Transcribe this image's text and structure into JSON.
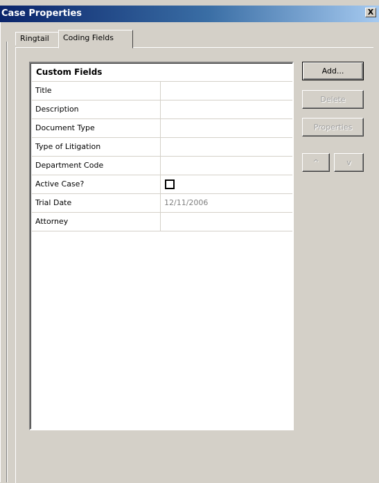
{
  "window": {
    "title": "Case Properties",
    "close_label": "X"
  },
  "tabs": [
    {
      "label": "Ringtail",
      "selected": false
    },
    {
      "label": "Coding Fields",
      "selected": true
    }
  ],
  "list": {
    "header": "Custom Fields",
    "rows": [
      {
        "name": "Title",
        "value": ""
      },
      {
        "name": "Description",
        "value": ""
      },
      {
        "name": "Document Type",
        "value": ""
      },
      {
        "name": "Type of Litigation",
        "value": ""
      },
      {
        "name": "Department Code",
        "value": ""
      },
      {
        "name": "Active Case?",
        "value": "",
        "checkbox": true,
        "checked": false
      },
      {
        "name": "Trial Date",
        "value": "12/11/2006"
      },
      {
        "name": "Attorney",
        "value": ""
      }
    ]
  },
  "buttons": {
    "add": "Add...",
    "delete": "Delete",
    "properties": "Properties",
    "up": "^",
    "down": "v"
  }
}
